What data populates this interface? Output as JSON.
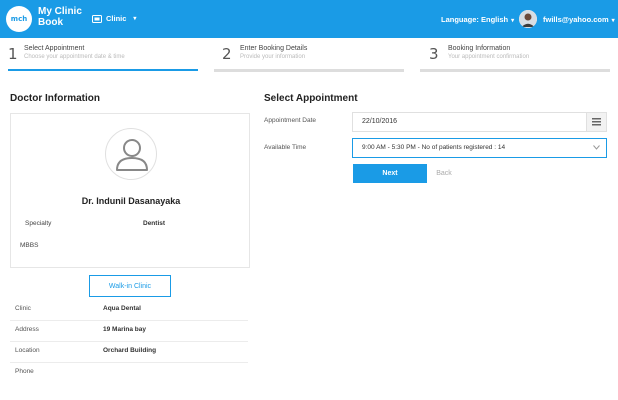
{
  "header": {
    "logo_text": "mch",
    "brand_line1": "My Clinic",
    "brand_line2": "Book",
    "clinic_menu_label": "Clinic",
    "language_label": "Language: English",
    "user_email": "fwills@yahoo.com",
    "accent_color": "#1a9be6"
  },
  "steps": [
    {
      "number": "1",
      "title": "Select Appointment",
      "subtitle": "Choose your appointment date & time",
      "active": true
    },
    {
      "number": "2",
      "title": "Enter Booking Details",
      "subtitle": "Provide your information",
      "active": false
    },
    {
      "number": "3",
      "title": "Booking Information",
      "subtitle": "Your appointment confirmation",
      "active": false
    }
  ],
  "doctor": {
    "section_title": "Doctor Information",
    "name": "Dr. Indunil Dasanayaka",
    "specialty_label": "Specialty",
    "specialty_value": "Dentist",
    "degree": "MBBS",
    "walkin_label": "Walk-in Clinic",
    "info": [
      {
        "label": "Clinic",
        "value": "Aqua Dental"
      },
      {
        "label": "Address",
        "value": "19 Marina bay"
      },
      {
        "label": "Location",
        "value": "Orchard Building"
      },
      {
        "label": "Phone",
        "value": ""
      }
    ]
  },
  "appointment": {
    "section_title": "Select Appointment",
    "date_label": "Appointment Date",
    "date_value": "22/10/2016",
    "time_label": "Available Time",
    "time_value": "9:00 AM - 5:30 PM - No of patients registered : 14",
    "next_label": "Next",
    "back_label": "Back"
  }
}
